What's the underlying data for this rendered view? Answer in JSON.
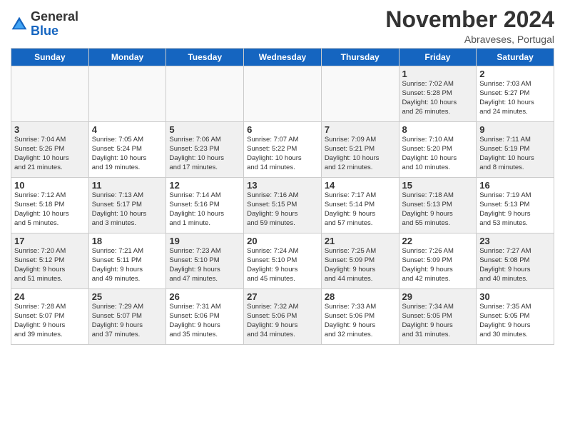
{
  "header": {
    "logo_general": "General",
    "logo_blue": "Blue",
    "month_title": "November 2024",
    "location": "Abraveses, Portugal"
  },
  "days_of_week": [
    "Sunday",
    "Monday",
    "Tuesday",
    "Wednesday",
    "Thursday",
    "Friday",
    "Saturday"
  ],
  "weeks": [
    [
      {
        "day": "",
        "text": "",
        "empty": true
      },
      {
        "day": "",
        "text": "",
        "empty": true
      },
      {
        "day": "",
        "text": "",
        "empty": true
      },
      {
        "day": "",
        "text": "",
        "empty": true
      },
      {
        "day": "",
        "text": "",
        "empty": true
      },
      {
        "day": "1",
        "text": "Sunrise: 7:02 AM\nSunset: 5:28 PM\nDaylight: 10 hours\nand 26 minutes.",
        "shaded": true
      },
      {
        "day": "2",
        "text": "Sunrise: 7:03 AM\nSunset: 5:27 PM\nDaylight: 10 hours\nand 24 minutes.",
        "shaded": false
      }
    ],
    [
      {
        "day": "3",
        "text": "Sunrise: 7:04 AM\nSunset: 5:26 PM\nDaylight: 10 hours\nand 21 minutes.",
        "shaded": true
      },
      {
        "day": "4",
        "text": "Sunrise: 7:05 AM\nSunset: 5:24 PM\nDaylight: 10 hours\nand 19 minutes.",
        "shaded": false
      },
      {
        "day": "5",
        "text": "Sunrise: 7:06 AM\nSunset: 5:23 PM\nDaylight: 10 hours\nand 17 minutes.",
        "shaded": true
      },
      {
        "day": "6",
        "text": "Sunrise: 7:07 AM\nSunset: 5:22 PM\nDaylight: 10 hours\nand 14 minutes.",
        "shaded": false
      },
      {
        "day": "7",
        "text": "Sunrise: 7:09 AM\nSunset: 5:21 PM\nDaylight: 10 hours\nand 12 minutes.",
        "shaded": true
      },
      {
        "day": "8",
        "text": "Sunrise: 7:10 AM\nSunset: 5:20 PM\nDaylight: 10 hours\nand 10 minutes.",
        "shaded": false
      },
      {
        "day": "9",
        "text": "Sunrise: 7:11 AM\nSunset: 5:19 PM\nDaylight: 10 hours\nand 8 minutes.",
        "shaded": true
      }
    ],
    [
      {
        "day": "10",
        "text": "Sunrise: 7:12 AM\nSunset: 5:18 PM\nDaylight: 10 hours\nand 5 minutes.",
        "shaded": false
      },
      {
        "day": "11",
        "text": "Sunrise: 7:13 AM\nSunset: 5:17 PM\nDaylight: 10 hours\nand 3 minutes.",
        "shaded": true
      },
      {
        "day": "12",
        "text": "Sunrise: 7:14 AM\nSunset: 5:16 PM\nDaylight: 10 hours\nand 1 minute.",
        "shaded": false
      },
      {
        "day": "13",
        "text": "Sunrise: 7:16 AM\nSunset: 5:15 PM\nDaylight: 9 hours\nand 59 minutes.",
        "shaded": true
      },
      {
        "day": "14",
        "text": "Sunrise: 7:17 AM\nSunset: 5:14 PM\nDaylight: 9 hours\nand 57 minutes.",
        "shaded": false
      },
      {
        "day": "15",
        "text": "Sunrise: 7:18 AM\nSunset: 5:13 PM\nDaylight: 9 hours\nand 55 minutes.",
        "shaded": true
      },
      {
        "day": "16",
        "text": "Sunrise: 7:19 AM\nSunset: 5:13 PM\nDaylight: 9 hours\nand 53 minutes.",
        "shaded": false
      }
    ],
    [
      {
        "day": "17",
        "text": "Sunrise: 7:20 AM\nSunset: 5:12 PM\nDaylight: 9 hours\nand 51 minutes.",
        "shaded": true
      },
      {
        "day": "18",
        "text": "Sunrise: 7:21 AM\nSunset: 5:11 PM\nDaylight: 9 hours\nand 49 minutes.",
        "shaded": false
      },
      {
        "day": "19",
        "text": "Sunrise: 7:23 AM\nSunset: 5:10 PM\nDaylight: 9 hours\nand 47 minutes.",
        "shaded": true
      },
      {
        "day": "20",
        "text": "Sunrise: 7:24 AM\nSunset: 5:10 PM\nDaylight: 9 hours\nand 45 minutes.",
        "shaded": false
      },
      {
        "day": "21",
        "text": "Sunrise: 7:25 AM\nSunset: 5:09 PM\nDaylight: 9 hours\nand 44 minutes.",
        "shaded": true
      },
      {
        "day": "22",
        "text": "Sunrise: 7:26 AM\nSunset: 5:09 PM\nDaylight: 9 hours\nand 42 minutes.",
        "shaded": false
      },
      {
        "day": "23",
        "text": "Sunrise: 7:27 AM\nSunset: 5:08 PM\nDaylight: 9 hours\nand 40 minutes.",
        "shaded": true
      }
    ],
    [
      {
        "day": "24",
        "text": "Sunrise: 7:28 AM\nSunset: 5:07 PM\nDaylight: 9 hours\nand 39 minutes.",
        "shaded": false
      },
      {
        "day": "25",
        "text": "Sunrise: 7:29 AM\nSunset: 5:07 PM\nDaylight: 9 hours\nand 37 minutes.",
        "shaded": true
      },
      {
        "day": "26",
        "text": "Sunrise: 7:31 AM\nSunset: 5:06 PM\nDaylight: 9 hours\nand 35 minutes.",
        "shaded": false
      },
      {
        "day": "27",
        "text": "Sunrise: 7:32 AM\nSunset: 5:06 PM\nDaylight: 9 hours\nand 34 minutes.",
        "shaded": true
      },
      {
        "day": "28",
        "text": "Sunrise: 7:33 AM\nSunset: 5:06 PM\nDaylight: 9 hours\nand 32 minutes.",
        "shaded": false
      },
      {
        "day": "29",
        "text": "Sunrise: 7:34 AM\nSunset: 5:05 PM\nDaylight: 9 hours\nand 31 minutes.",
        "shaded": true
      },
      {
        "day": "30",
        "text": "Sunrise: 7:35 AM\nSunset: 5:05 PM\nDaylight: 9 hours\nand 30 minutes.",
        "shaded": false
      }
    ]
  ]
}
